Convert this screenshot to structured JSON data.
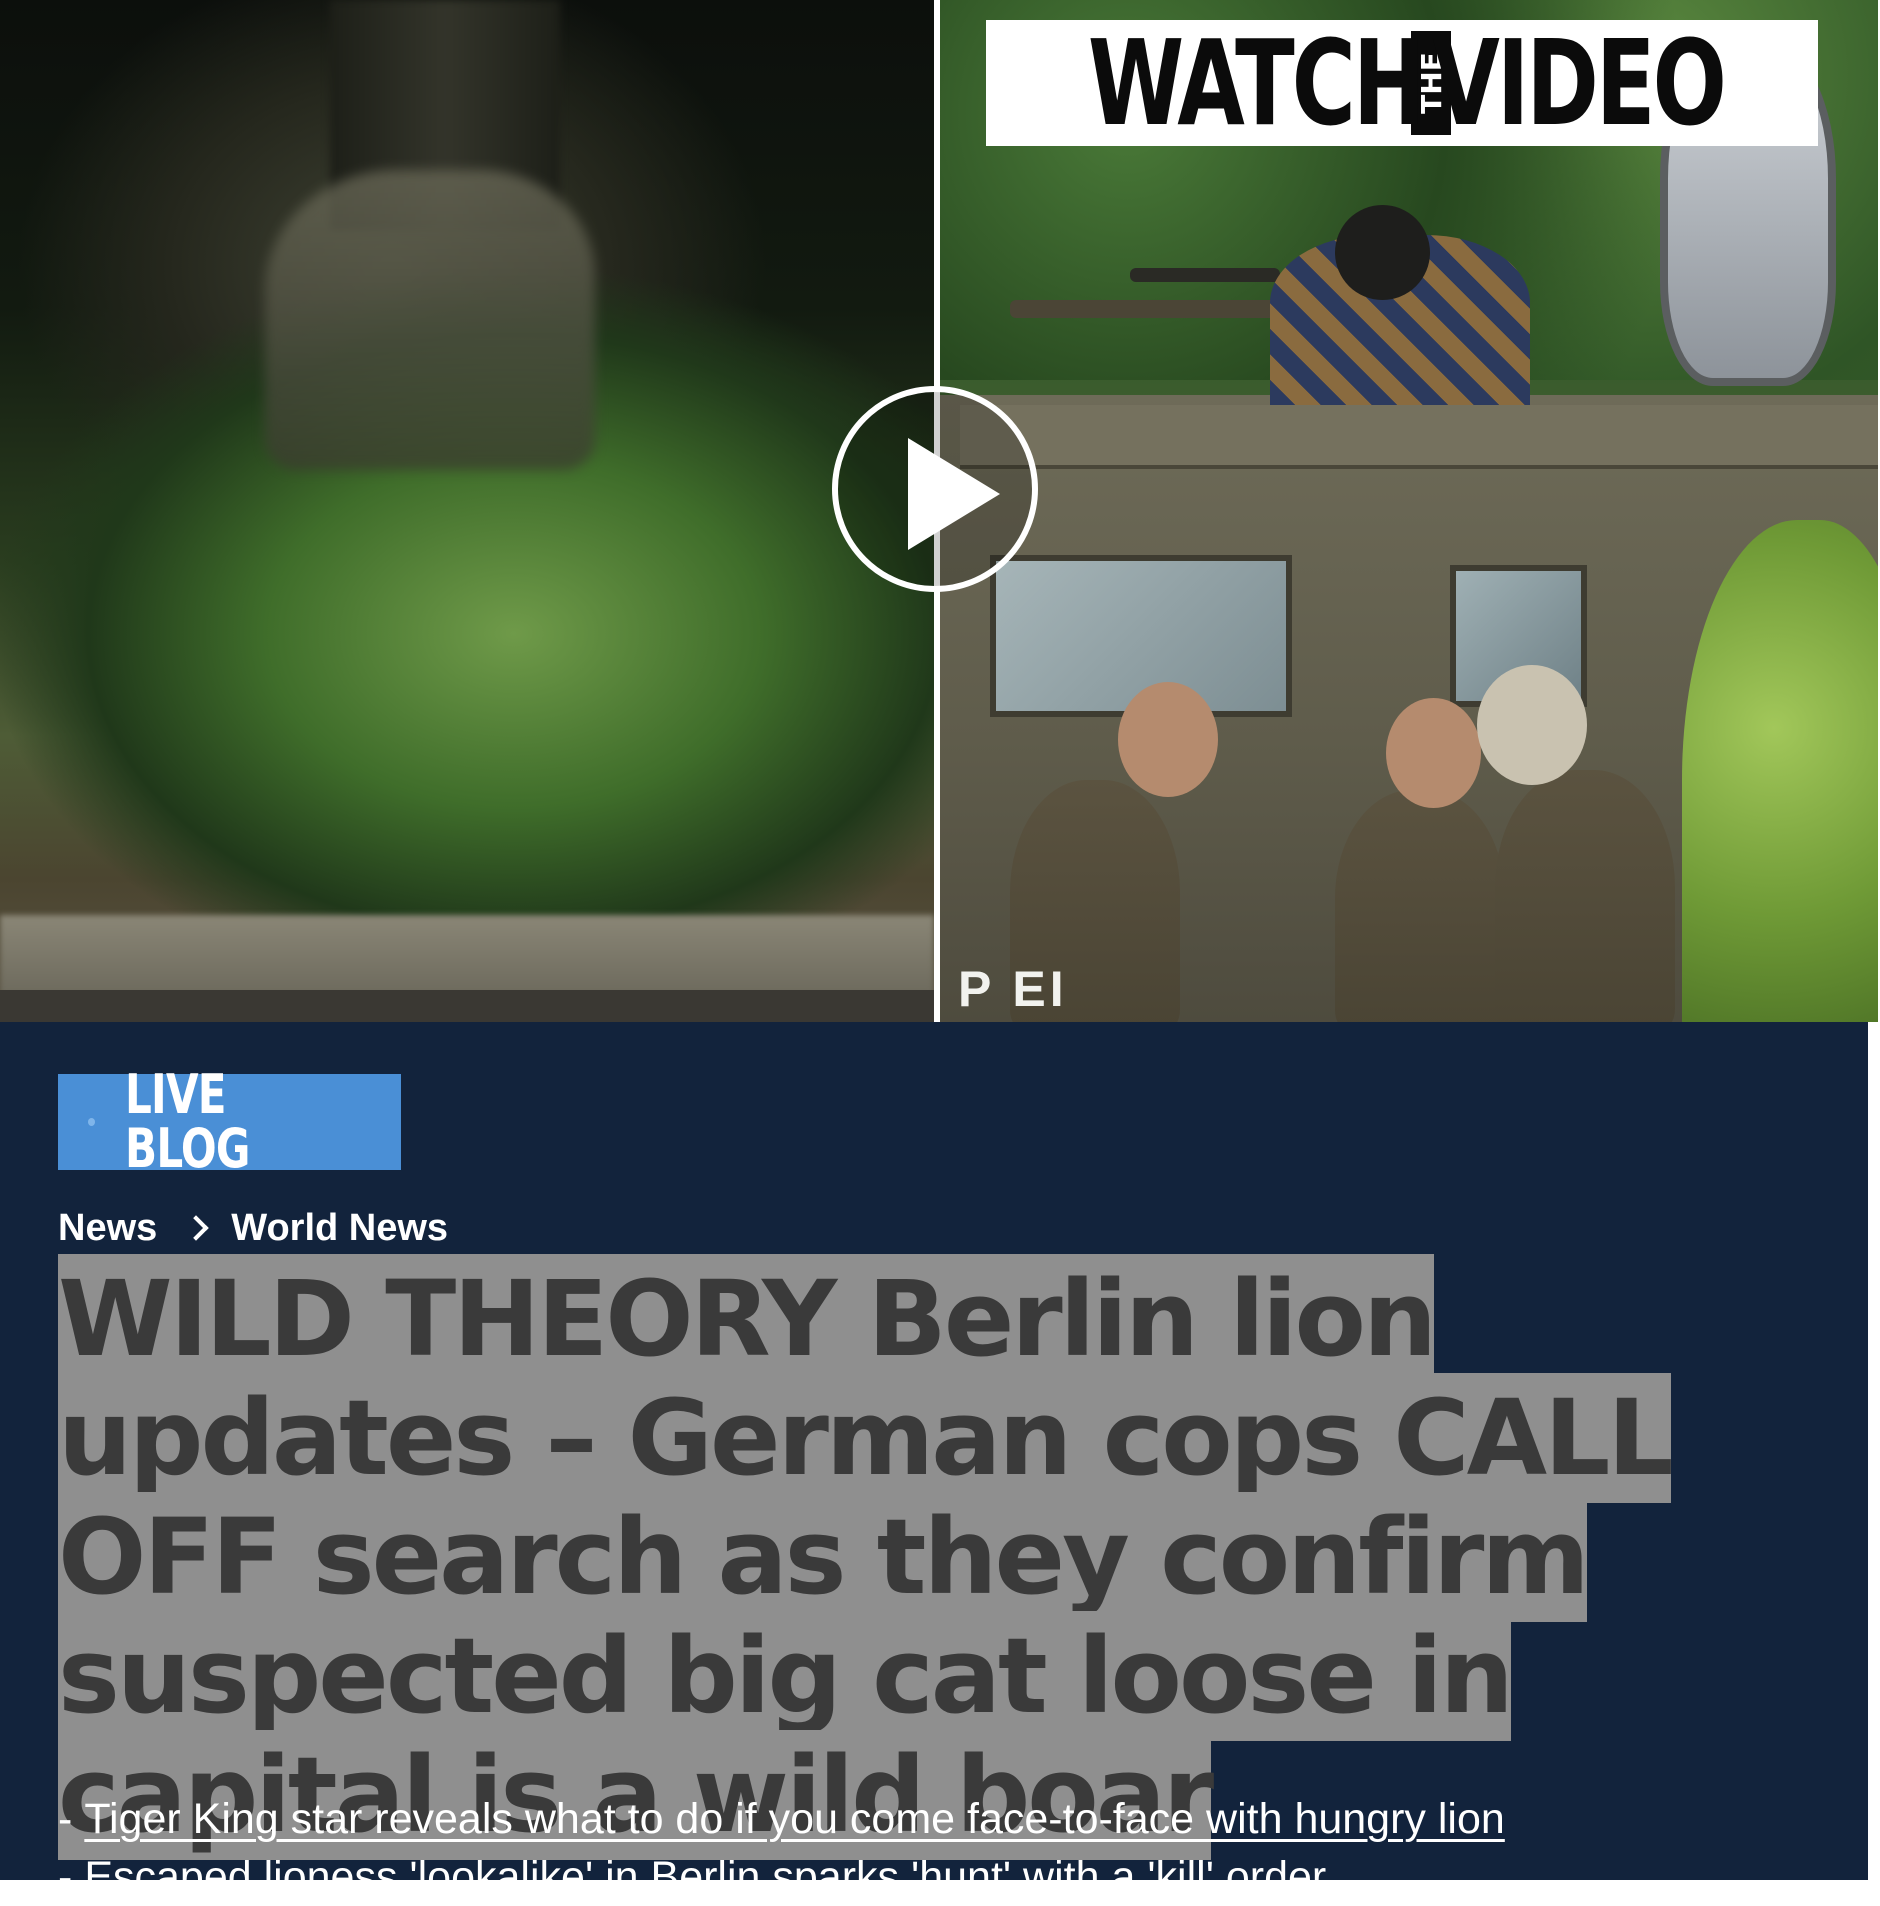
{
  "video": {
    "overlay_prefix": "WATCH",
    "overlay_small": "THE",
    "overlay_suffix": "VIDEO",
    "vehicle_marking": "P     EI",
    "play_icon": "play-icon"
  },
  "badge": {
    "label": "LIVE BLOG"
  },
  "breadcrumb": [
    {
      "label": "News"
    },
    {
      "label": "World News"
    }
  ],
  "headline": "WILD THEORY Berlin lion updates – German cops CALL OFF search as they confirm suspected big cat loose in capital is a wild boar",
  "related_links": [
    {
      "prefix": "-",
      "text": "Tiger King star reveals what to do if you come face-to-face with hungry lion"
    },
    {
      "prefix": "-",
      "text": "Escaped lioness 'lookalike' in Berlin sparks 'hunt' with a 'kill' order"
    }
  ],
  "colors": {
    "article_background": "#12233c",
    "badge_background": "#4a8fd6",
    "headline_highlight": "#8f8f8f"
  }
}
